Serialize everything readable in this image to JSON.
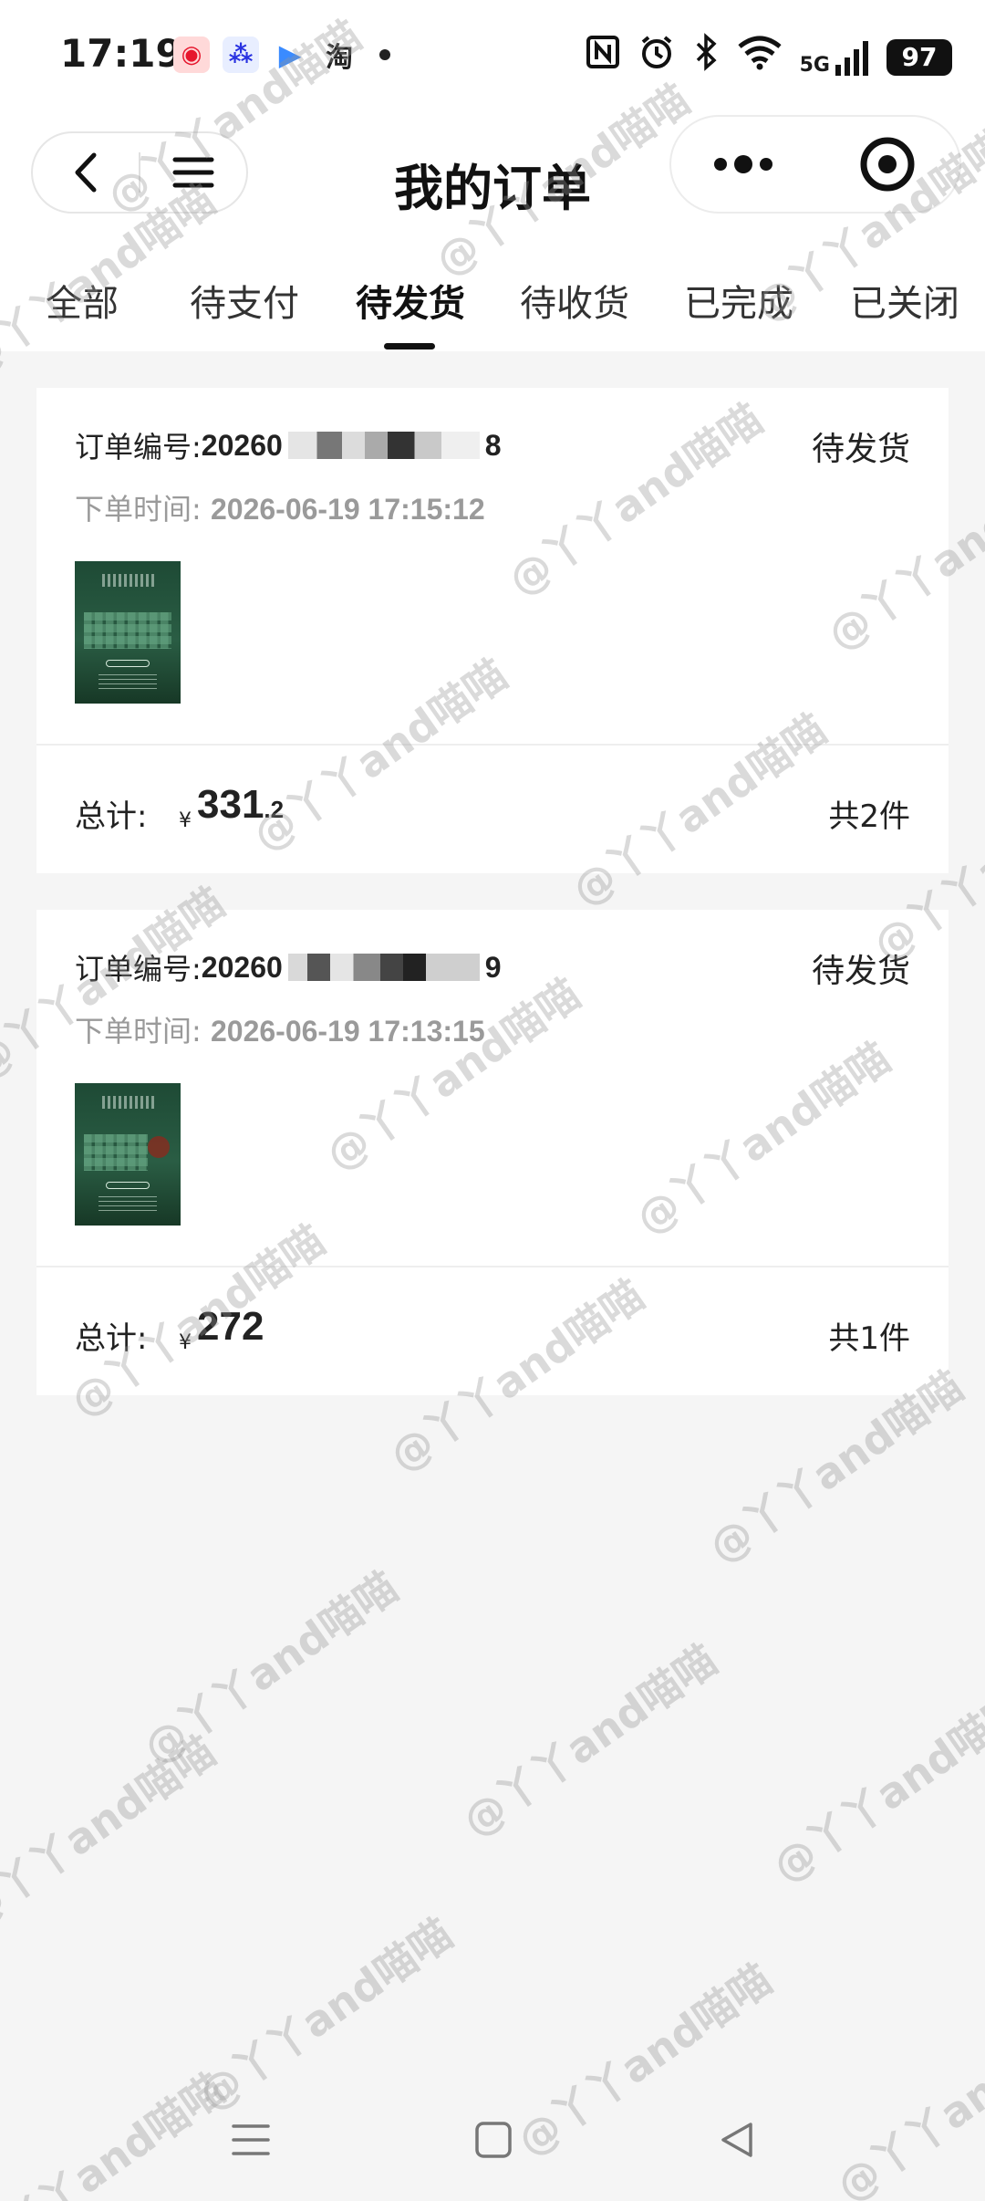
{
  "status_bar": {
    "time": "17:19",
    "apps": [
      "微博",
      "百度",
      "▶",
      "淘"
    ],
    "signal": "5G",
    "battery": "97"
  },
  "header": {
    "title": "我的订单"
  },
  "tabs": [
    {
      "label": "全部",
      "active": false
    },
    {
      "label": "待支付",
      "active": false
    },
    {
      "label": "待发货",
      "active": true
    },
    {
      "label": "待收货",
      "active": false
    },
    {
      "label": "已完成",
      "active": false
    },
    {
      "label": "已关闭",
      "active": false
    }
  ],
  "orders": [
    {
      "number_label": "订单编号:",
      "number_prefix": "20260",
      "number_suffix": "8",
      "status": "待发货",
      "time_label": "下单时间:",
      "time": "2026-06-19 17:15:12",
      "total_label": "总计:",
      "currency": "¥",
      "amount_int": "331",
      "amount_dec": ".2",
      "count": "共2件"
    },
    {
      "number_label": "订单编号:",
      "number_prefix": "20260",
      "number_suffix": "9",
      "status": "待发货",
      "time_label": "下单时间:",
      "time": "2026-06-19 17:13:15",
      "total_label": "总计:",
      "currency": "¥",
      "amount_int": "272",
      "amount_dec": "",
      "count": "共1件"
    }
  ],
  "watermark": "@丫丫and喵喵",
  "colors": {
    "background": "#f5f5f5",
    "card": "#ffffff",
    "text": "#1a1a1a",
    "muted": "#9a9a9a",
    "thumbnail_green": "#1e4a35"
  },
  "icons": {
    "back": "chevron-left-icon",
    "menu": "hamburger-menu-icon",
    "more": "more-dots-icon",
    "target": "capsule-close-icon",
    "nav_menu": "nav-recents-icon",
    "nav_home": "nav-home-icon",
    "nav_back": "nav-back-icon"
  }
}
